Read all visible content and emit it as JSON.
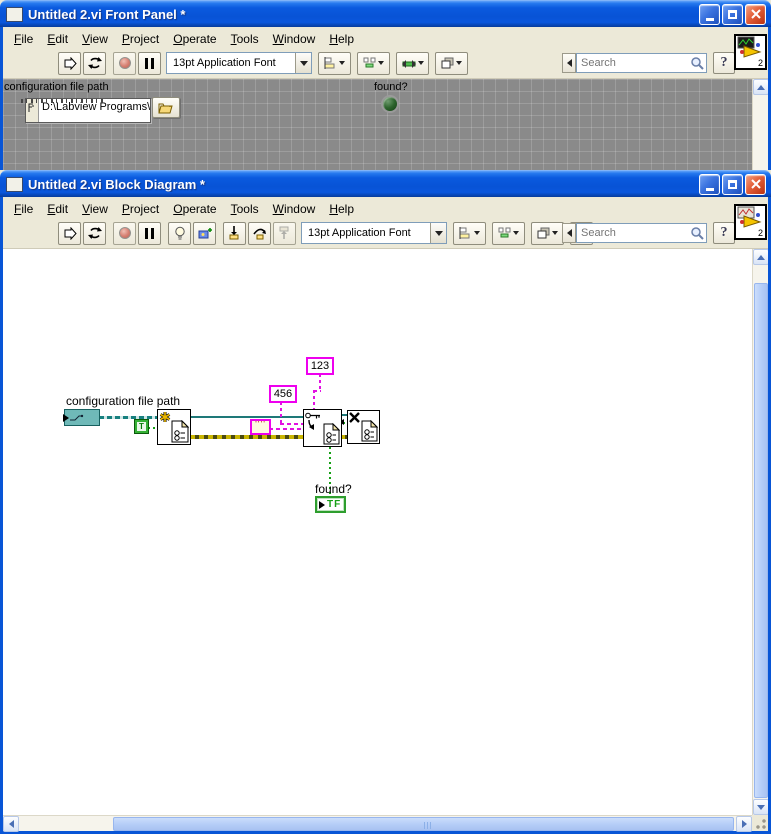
{
  "front_panel": {
    "title": "Untitled 2.vi Front Panel *",
    "menu": [
      "File",
      "Edit",
      "View",
      "Project",
      "Operate",
      "Tools",
      "Window",
      "Help"
    ],
    "toolbar": {
      "font_selector": "13pt Application Font",
      "search_placeholder": "Search",
      "badge": "2"
    },
    "panel": {
      "path_label": "configuration file path",
      "path_value": "D:\\Labview Programs\\",
      "found_label": "found?"
    }
  },
  "block_diagram": {
    "title": "Untitled 2.vi Block Diagram *",
    "menu": [
      "File",
      "Edit",
      "View",
      "Project",
      "Operate",
      "Tools",
      "Window",
      "Help"
    ],
    "toolbar": {
      "font_selector": "13pt Application Font",
      "search_placeholder": "Search",
      "badge": "2"
    },
    "diagram": {
      "path_label": "configuration file path",
      "true_constant": "T",
      "const_456": "456",
      "const_123": "123",
      "found_label": "found?",
      "tf_text": "TF"
    }
  }
}
